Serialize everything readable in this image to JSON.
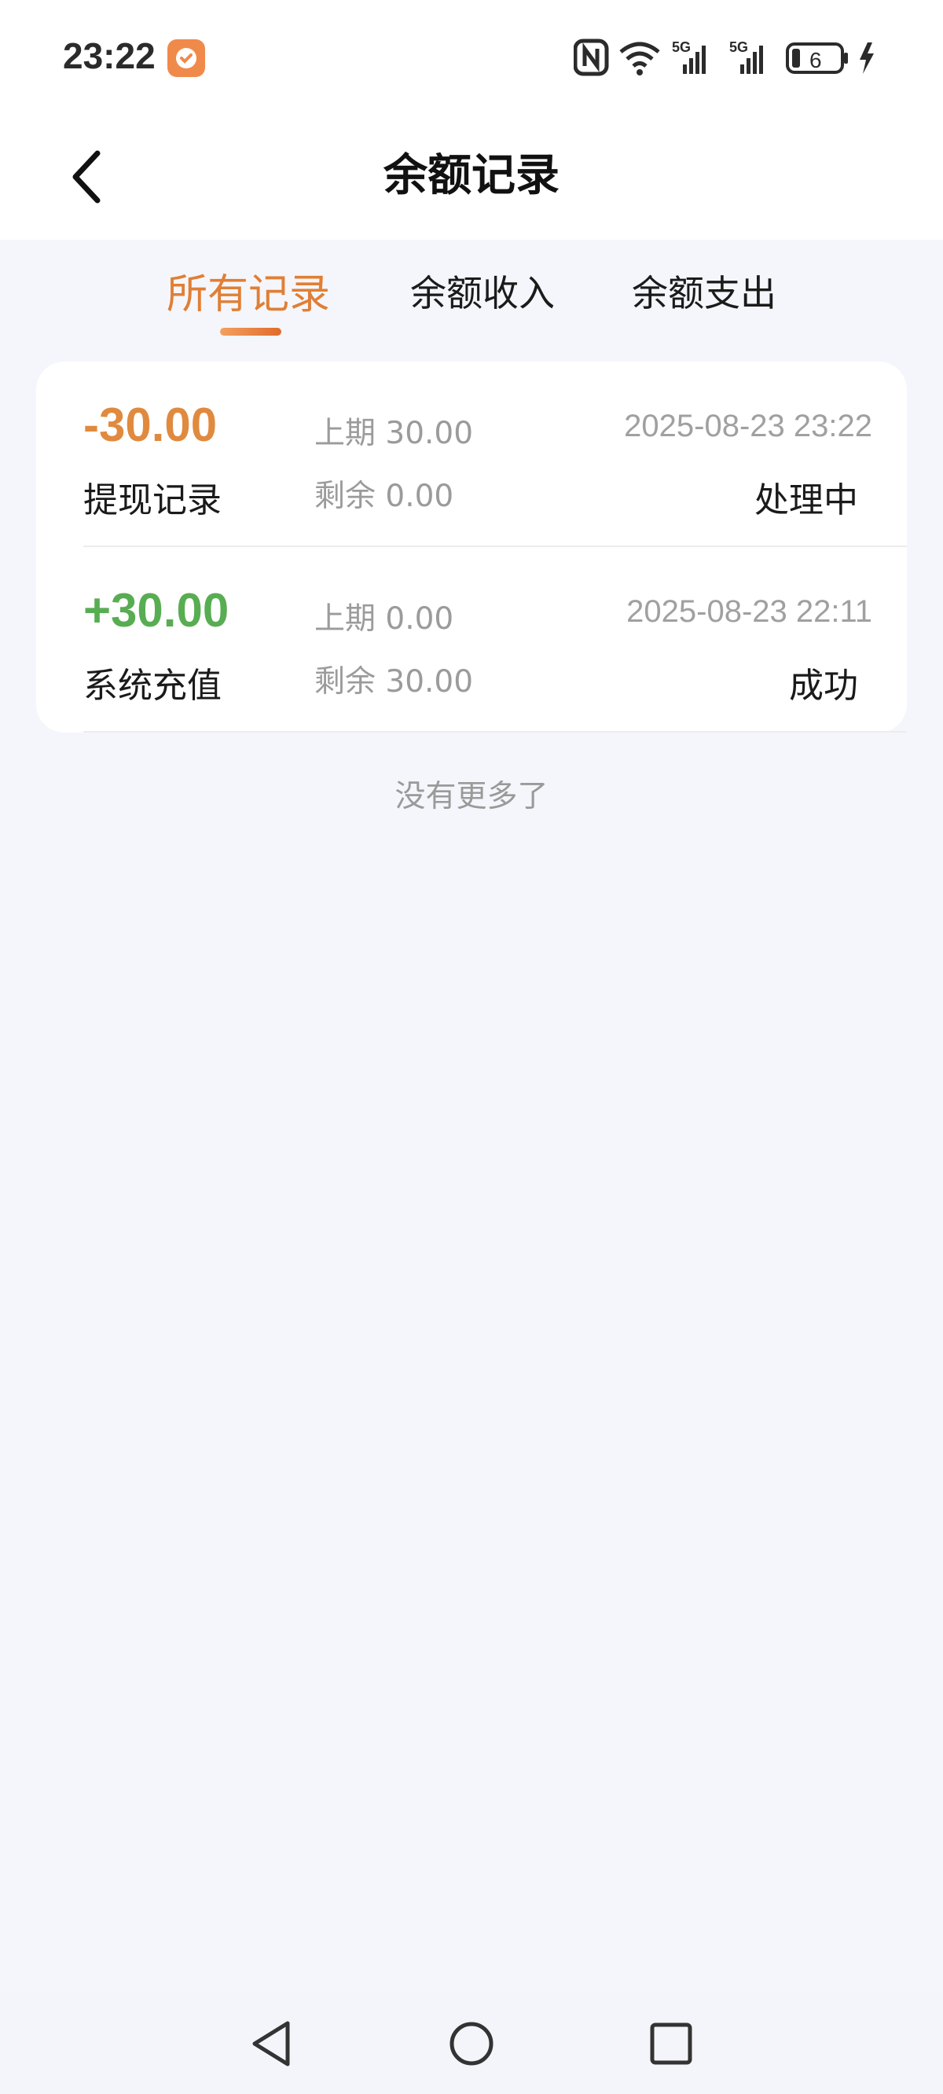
{
  "status_bar": {
    "time": "23:22",
    "network_1": "5G",
    "network_2": "5G",
    "battery": "6",
    "icons": [
      "app-notification-icon",
      "nfc-icon",
      "wifi-icon",
      "signal-icon",
      "signal-icon",
      "battery-icon",
      "charging-icon"
    ]
  },
  "header": {
    "title": "余额记录",
    "back_icon": "chevron-left-icon"
  },
  "tabs": [
    {
      "label": "所有记录",
      "active": true
    },
    {
      "label": "余额收入",
      "active": false
    },
    {
      "label": "余额支出",
      "active": false
    }
  ],
  "colors": {
    "accent": "#e07f35",
    "negative": "#e08a3f",
    "positive": "#58ad52",
    "background": "#f5f6fb"
  },
  "records": [
    {
      "amount": "-30.00",
      "type": "提现记录",
      "previous": "上期 30.00",
      "remaining": "剩余 0.00",
      "time": "2025-08-23 23:22",
      "status": "处理中"
    },
    {
      "amount": "+30.00",
      "type": "系统充值",
      "previous": "上期 0.00",
      "remaining": "剩余 30.00",
      "time": "2025-08-23 22:11",
      "status": "成功"
    }
  ],
  "footer_text": "没有更多了",
  "nav": {
    "icons": [
      "nav-back-icon",
      "nav-home-icon",
      "nav-recent-icon"
    ]
  }
}
